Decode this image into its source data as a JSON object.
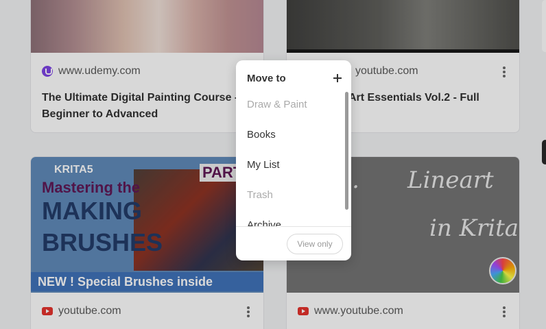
{
  "cards": [
    {
      "source": "www.udemy.com",
      "title": "The Ultimate Digital Painting Course - Beginner to Advanced"
    },
    {
      "source": "youtube.com",
      "title": "Art Essentials Vol.2 - Full"
    },
    {
      "source": "youtube.com",
      "thumb_lines": [
        "KRITA5",
        "Mastering the",
        "MAKING",
        "BRUSHES",
        "NEW ! Special Brushes inside",
        "PART"
      ]
    },
    {
      "source": "www.youtube.com",
      "thumb_lines": [
        "to...",
        "Lineart",
        "in Krita"
      ]
    }
  ],
  "popup": {
    "title": "Move to",
    "items": [
      {
        "label": "Draw & Paint",
        "disabled": true
      },
      {
        "label": "Books",
        "disabled": false
      },
      {
        "label": "My List",
        "disabled": false
      },
      {
        "label": "Trash",
        "disabled": true
      },
      {
        "label": "Archive",
        "disabled": false
      }
    ],
    "view_only_label": "View only"
  },
  "colors": {
    "udemy": "#7b3fe4",
    "youtube": "#e52d27"
  }
}
